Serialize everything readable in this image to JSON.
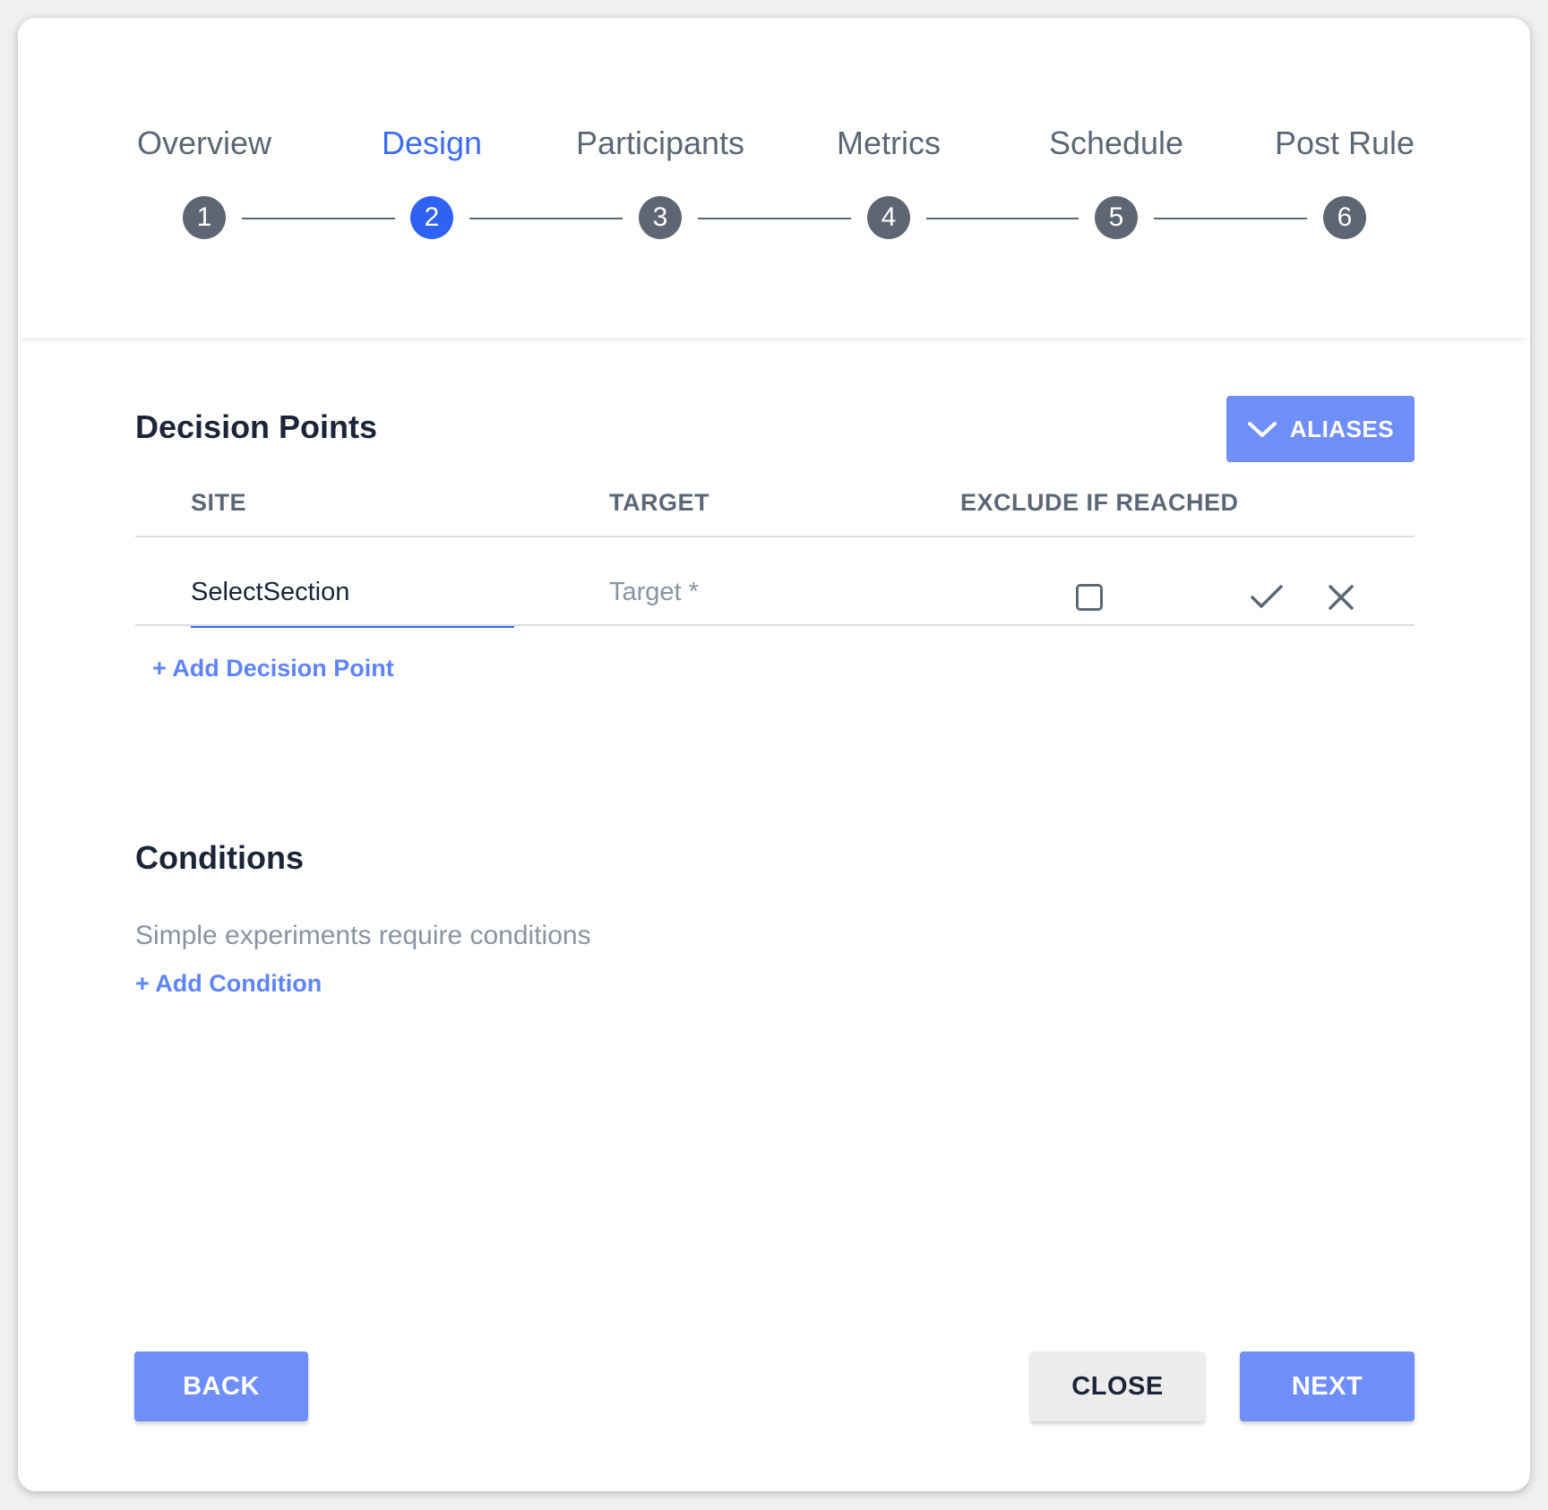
{
  "stepper": {
    "steps": [
      {
        "label": "Overview",
        "number": "1",
        "active": false
      },
      {
        "label": "Design",
        "number": "2",
        "active": true
      },
      {
        "label": "Participants",
        "number": "3",
        "active": false
      },
      {
        "label": "Metrics",
        "number": "4",
        "active": false
      },
      {
        "label": "Schedule",
        "number": "5",
        "active": false
      },
      {
        "label": "Post Rule",
        "number": "6",
        "active": false
      }
    ]
  },
  "decision_points": {
    "title": "Decision Points",
    "aliases_label": "ALIASES",
    "columns": [
      "SITE",
      "TARGET",
      "EXCLUDE IF REACHED"
    ],
    "row": {
      "site_value": "SelectSection",
      "target_value": "",
      "target_placeholder": "Target *",
      "exclude_checked": false
    },
    "add_label": "+ Add Decision Point"
  },
  "conditions": {
    "title": "Conditions",
    "subtitle": "Simple experiments require conditions",
    "add_label": "+ Add Condition"
  },
  "footer": {
    "back_label": "BACK",
    "close_label": "CLOSE",
    "next_label": "NEXT"
  },
  "colors": {
    "accent": "#3b6cf4",
    "button_primary": "#6f8ef7",
    "step_inactive": "#5f6673",
    "text_dark": "#1d2438",
    "text_muted": "#8a93a0"
  },
  "icons": {
    "aliases": "chevron-down-icon",
    "confirm": "check-icon",
    "cancel": "close-icon"
  }
}
